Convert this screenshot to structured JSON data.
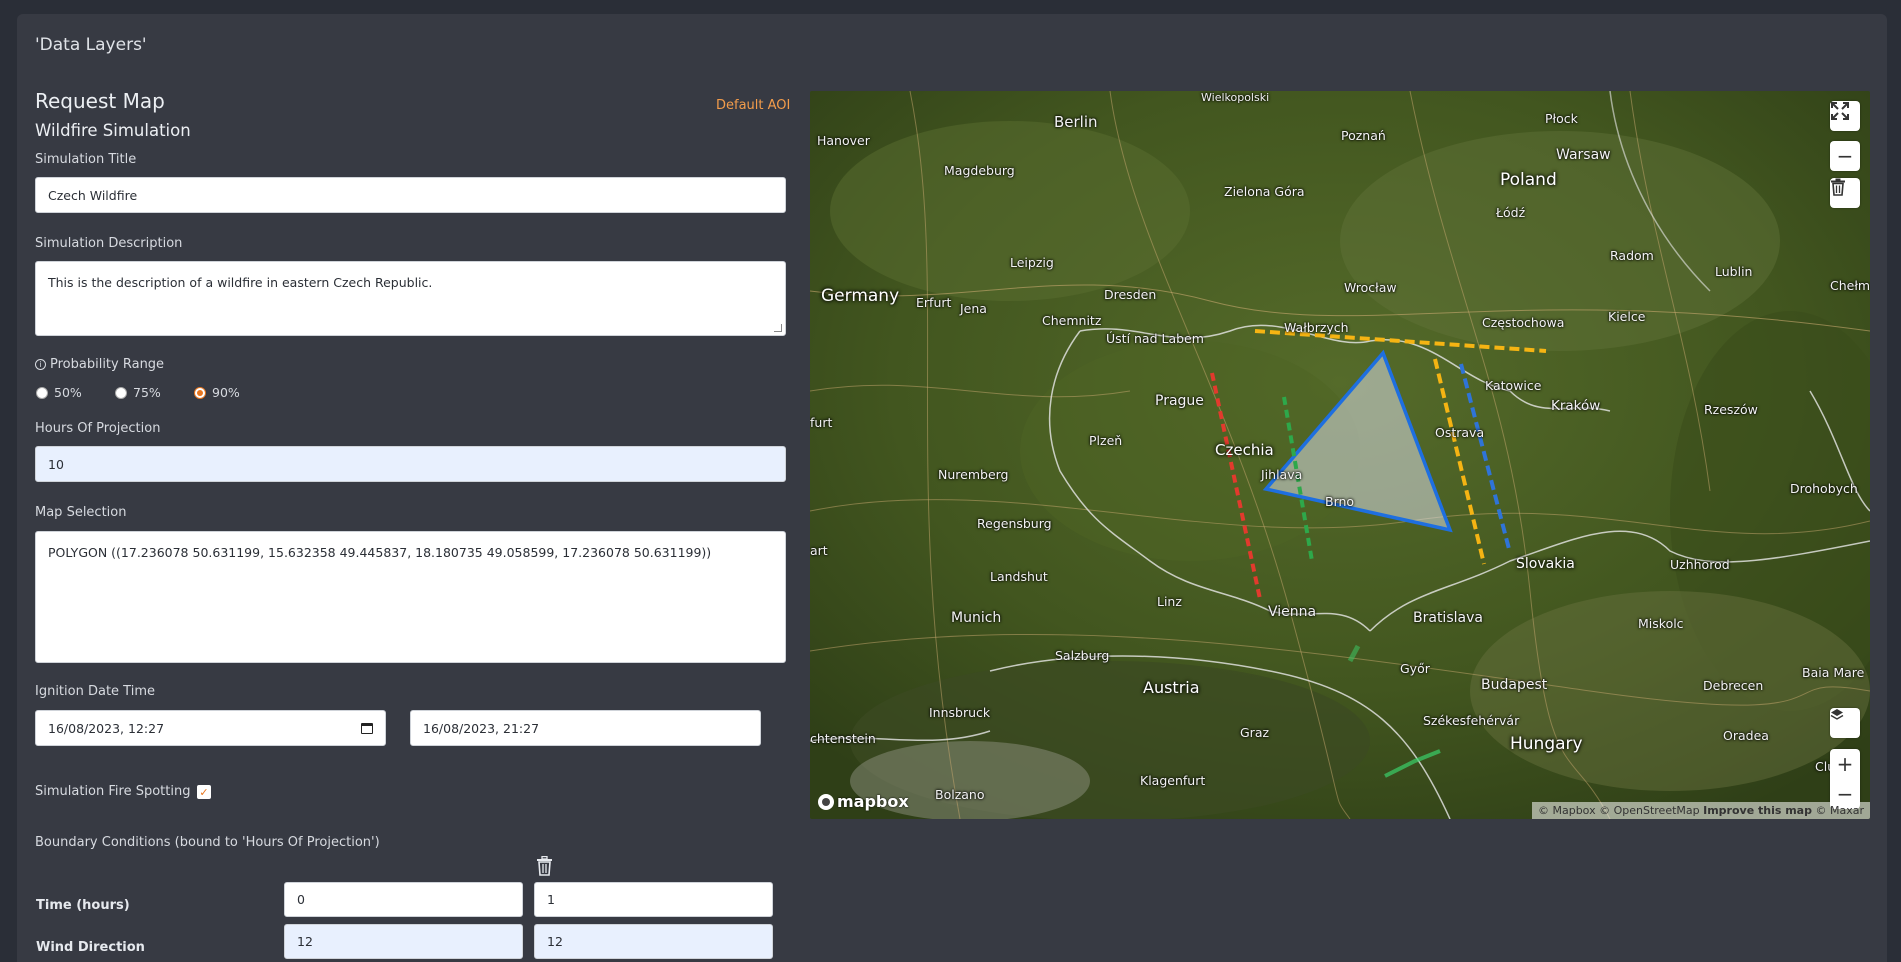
{
  "panel": {
    "title": "'Data Layers'"
  },
  "form": {
    "heading": "Request Map",
    "subheading": "Wildfire Simulation",
    "default_aoi": "Default AOI",
    "simulation_title": {
      "label": "Simulation Title",
      "value": "Czech Wildfire"
    },
    "simulation_description": {
      "label": "Simulation Description",
      "value": "This is the description of a wildfire in eastern Czech Republic."
    },
    "probability_range": {
      "label": "Probability Range",
      "options": [
        "50%",
        "75%",
        "90%"
      ],
      "selected": "90%"
    },
    "hours_of_projection": {
      "label": "Hours Of Projection",
      "value": "10"
    },
    "map_selection": {
      "label": "Map Selection",
      "value": "POLYGON ((17.236078 50.631199, 15.632358 49.445837, 18.180735 49.058599, 17.236078 50.631199))"
    },
    "ignition": {
      "label": "Ignition Date Time",
      "start": "16/08/2023, 12:27",
      "end": "16/08/2023, 21:27"
    },
    "fire_spotting": {
      "label": "Simulation Fire Spotting",
      "checked": true
    },
    "boundary": {
      "label": "Boundary Conditions (bound to 'Hours Of Projection')",
      "rows": [
        {
          "label": "Time (hours)",
          "values": [
            "0",
            "1"
          ]
        },
        {
          "label": "Wind Direction",
          "values": [
            "12",
            "12"
          ]
        }
      ]
    }
  },
  "map": {
    "attribution_mapbox": "© Mapbox",
    "attribution_osm": "© OpenStreetMap",
    "attribution_improve": "Improve this map",
    "attribution_maxar": "© Maxar",
    "logo": "mapbox",
    "countries": [
      "Germany",
      "Poland",
      "Czechia",
      "Slovakia",
      "Austria",
      "Hungary"
    ],
    "cities": [
      "Berlin",
      "Wielkopolski",
      "Hanover",
      "Magdeburg",
      "Poznań",
      "Płock",
      "Warsaw",
      "Zielona Góra",
      "Łódź",
      "Radom",
      "Lublin",
      "Chełm",
      "Leipzig",
      "Erfurt",
      "Jena",
      "Dresden",
      "Chemnitz",
      "Wrocław",
      "Wałbrzych",
      "Częstochowa",
      "Kielce",
      "Ústí nad Labem",
      "Prague",
      "Katowice",
      "Kraków",
      "Rzeszów",
      "Plzeň",
      "Ostrava",
      "Jihlava",
      "Brno",
      "Nuremberg",
      "Regensburg",
      "Landshut",
      "Munich",
      "Linz",
      "Vienna",
      "Bratislava",
      "Salzburg",
      "Innsbruck",
      "Graz",
      "Klagenfurt",
      "Bolzano",
      "Győr",
      "Budapest",
      "Székesfehérvár",
      "Miskolc",
      "Debrecen",
      "Oradea",
      "Uzhhorod",
      "Drohobych",
      "Baia Mare",
      "Cluj"
    ],
    "partial_labels": [
      "furt",
      "art",
      "chtenstein"
    ]
  }
}
